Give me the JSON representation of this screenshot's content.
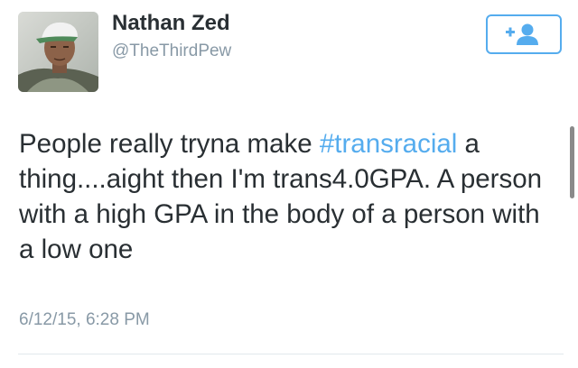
{
  "user": {
    "display_name": "Nathan Zed",
    "username": "@TheThirdPew",
    "avatar_icon": "user-avatar"
  },
  "follow_button": {
    "icon": "add-user-icon",
    "plus_glyph": "+",
    "color": "#55acee"
  },
  "tweet": {
    "text_before": "People really tryna make ",
    "hashtag": "#transracial",
    "text_after": " a thing....aight then I'm trans4.0GPA. A person with a high GPA in the body of a person with a low one",
    "timestamp": "6/12/15, 6:28 PM"
  },
  "colors": {
    "link": "#55acee",
    "text": "#292f33",
    "secondary": "#8899a6"
  }
}
